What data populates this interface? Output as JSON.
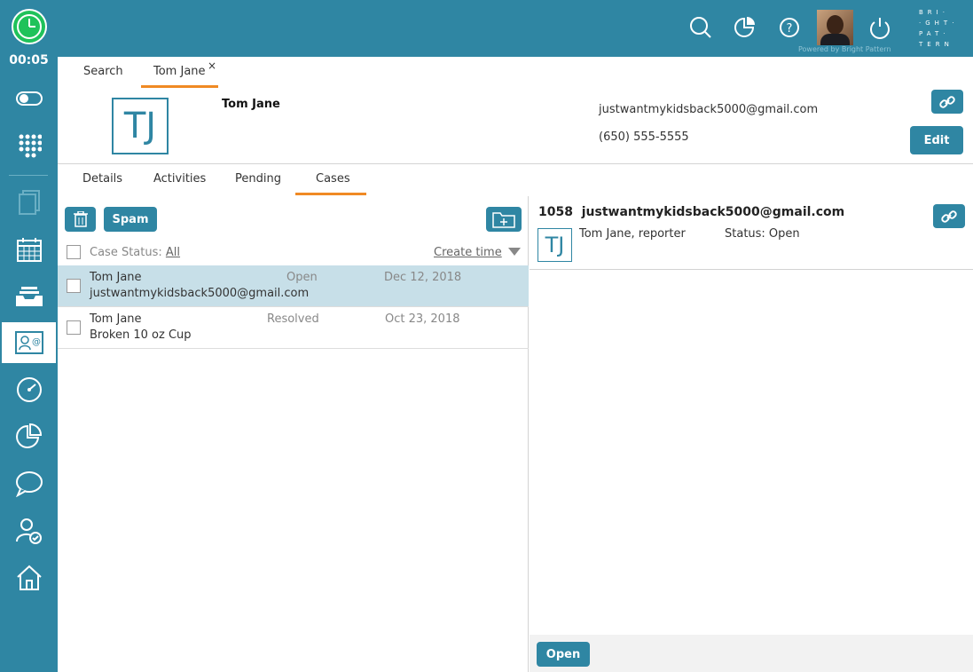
{
  "timer": "00:05",
  "powered_by": "Powered by Bright Pattern",
  "brand_lines": [
    "BRI·",
    "·GHT·",
    "PAT·",
    "TERN"
  ],
  "top_tabs": {
    "search": "Search",
    "contact": "Tom Jane",
    "close": "×"
  },
  "contact": {
    "initials": "TJ",
    "name": "Tom Jane",
    "email": "justwantmykidsback5000@gmail.com",
    "phone": "(650) 555-5555",
    "edit_label": "Edit"
  },
  "sub_tabs": [
    "Details",
    "Activities",
    "Pending",
    "Cases"
  ],
  "cases_toolbar": {
    "spam_label": "Spam",
    "status_label": "Case Status:",
    "status_value": "All",
    "sort_label": "Create time"
  },
  "cases": [
    {
      "name": "Tom Jane",
      "subject": "justwantmykidsback5000@gmail.com",
      "status": "Open",
      "date": "Dec 12, 2018"
    },
    {
      "name": "Tom Jane",
      "subject": "Broken 10 oz Cup",
      "status": "Resolved",
      "date": "Oct 23, 2018"
    }
  ],
  "case_detail": {
    "number": "1058",
    "title": "justwantmykidsback5000@gmail.com",
    "initials": "TJ",
    "reporter": "Tom Jane, reporter",
    "status": "Status: Open",
    "open_label": "Open"
  },
  "colors": {
    "brand": "#2f86a3",
    "accent": "#f08a24",
    "clock": "#1fc25a",
    "selected_row": "#c7dfe8"
  },
  "icons": {
    "top": [
      "search-icon",
      "stats-icon",
      "help-icon",
      "power-icon"
    ],
    "side": [
      "toggle-icon",
      "dialpad-icon",
      "documents-icon",
      "calendar-icon",
      "inbox-icon",
      "contacts-icon",
      "dashboard-icon",
      "reports-icon",
      "chat-icon",
      "user-check-icon",
      "home-icon"
    ]
  }
}
